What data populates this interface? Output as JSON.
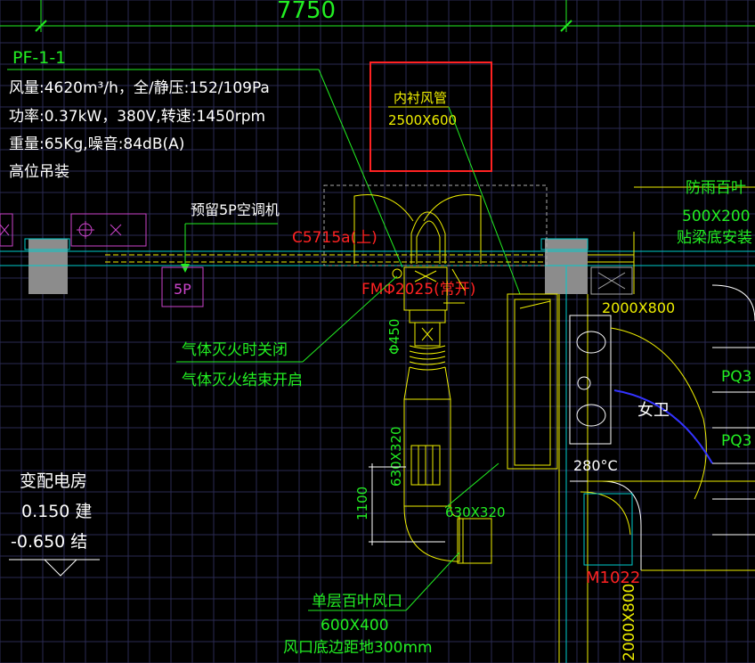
{
  "colors": {
    "background": "#000000",
    "grid": "#2a2a52",
    "dimension_green": "#22ee22",
    "cad_yellow": "#eeee00",
    "cad_cyan": "#00cccc",
    "cad_red": "#ff2222",
    "cad_magenta": "#cc44cc",
    "cad_blue": "#3333ff",
    "wall_gray": "#8c8c8c",
    "white": "#ffffff"
  },
  "labels": {
    "top_dimension": "7750",
    "fan_id": "PF-1-1",
    "fan_airflow": "风量:4620m³/h，全/静压:152/109Pa",
    "fan_power": "功率:0.37kW，380V,转速:1450rpm",
    "fan_weight": "重量:65Kg,噪音:84dB(A)",
    "fan_mount": "高位吊装",
    "lined_duct_title": "内衬风管",
    "lined_duct_size": "2500X600",
    "reserved_ac": "预留5P空调机",
    "ac_unit": "5P",
    "window_code": "C5715a(上)",
    "damper_code": "FMΦ2025(常开)",
    "gas_close": "气体灭火时关闭",
    "gas_open": "气体灭火结束开启",
    "duct_diameter": "Φ450",
    "louver_title": "防雨百叶",
    "louver_size": "500X200",
    "louver_mount": "贴梁底安装",
    "opening_size": "2000X800",
    "pq_label_1": "PQ3",
    "pq_label_2": "PQ3",
    "toilet_label": "女卫",
    "fire_damper_temp": "280°C",
    "door_code": "M1022",
    "door_size": "2000X800",
    "duct_vertical_size": "630X320",
    "duct_outlet_size": "630X320",
    "height_dim": "1100",
    "single_louver_title": "单层百叶风口",
    "single_louver_size": "600X400",
    "single_louver_height": "风口底边距地300mm",
    "room_name": "变配电房",
    "elev_arch": "0.150 建",
    "elev_struct": "-0.650 结"
  }
}
